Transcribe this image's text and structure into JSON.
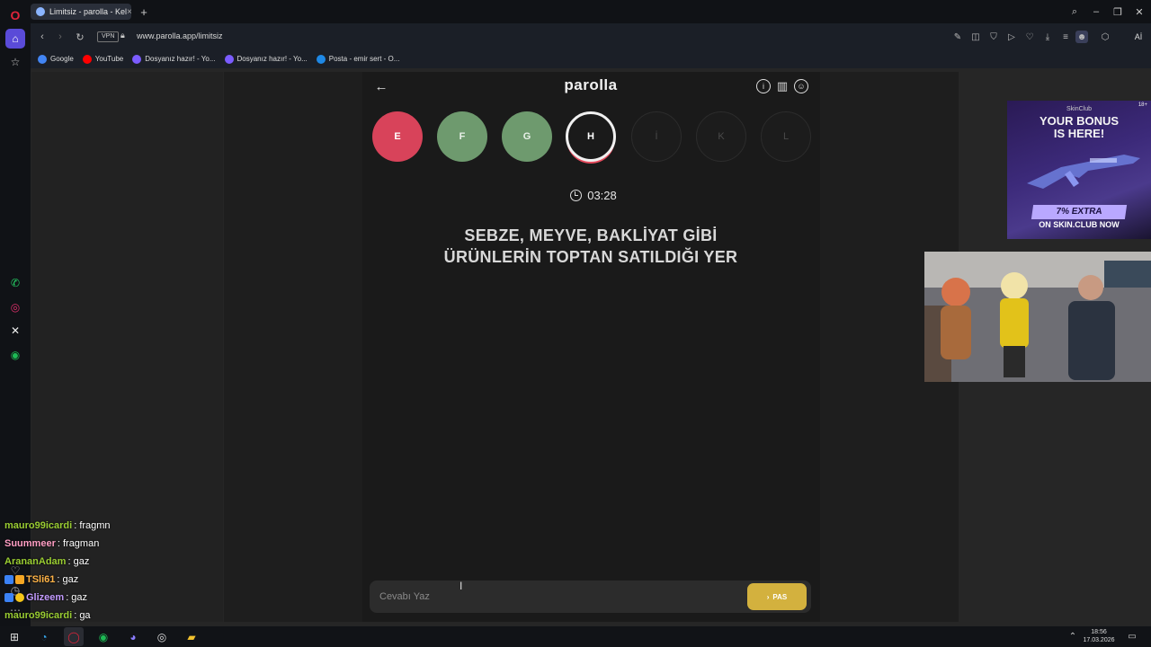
{
  "browser": {
    "tab_title": "Limitsiz - parolla - Kel",
    "tab_close": "×",
    "new_tab": "+",
    "url": "www.parolla.app/limitsiz",
    "vpn_label": "VPN",
    "ai_label": "Aİ"
  },
  "bookmarks": [
    {
      "label": "Google",
      "color": "#4285f4"
    },
    {
      "label": "YouTube",
      "color": "#ff0000"
    },
    {
      "label": "Dosyanız hazır! - Yo...",
      "color": "#7b5cff"
    },
    {
      "label": "Dosyanız hazır! - Yo...",
      "color": "#7b5cff"
    },
    {
      "label": "Posta - emir sert - O...",
      "color": "#1e88e5"
    }
  ],
  "game": {
    "logo": "parolla",
    "back_icon": "←",
    "info_icon": "i",
    "stats_icon": "▥",
    "profile_icon": "☺",
    "letters": [
      {
        "letter": "E",
        "state": "wrong"
      },
      {
        "letter": "F",
        "state": "correct"
      },
      {
        "letter": "G",
        "state": "correct"
      },
      {
        "letter": "H",
        "state": "current"
      },
      {
        "letter": "İ",
        "state": "empty"
      },
      {
        "letter": "K",
        "state": "empty"
      },
      {
        "letter": "L",
        "state": "empty"
      }
    ],
    "timer": "03:28",
    "question_line1": "SEBZE, MEYVE, BAKLİYAT GİBİ",
    "question_line2": "ÜRÜNLERİN TOPTAN SATILDIĞI YER",
    "answer_placeholder": "Cevabı Yaz",
    "pass_label": "PAS",
    "pass_color": "#d3b13e"
  },
  "ad": {
    "brand": "SkinClub",
    "rating": "18+",
    "headline_line1": "YOUR BONUS",
    "headline_line2": "IS HERE!",
    "extra": "7% EXTRA",
    "cta": "ON SKIN.CLUB NOW"
  },
  "chat": [
    {
      "user": "mauro99icardi",
      "message": ": fragmn",
      "color": "#9acd32"
    },
    {
      "user": "Suummeer",
      "message": ": fragman",
      "color": "#ff9ec4"
    },
    {
      "user": "ArananAdam",
      "message": ": gaz",
      "color": "#9acd32"
    },
    {
      "user": "TSli61",
      "message": ": gaz",
      "color": "#ffb347"
    },
    {
      "user": "Glizeem",
      "message": ": gaz",
      "color": "#c39bff"
    },
    {
      "user": "mauro99icardi",
      "message": ": ga",
      "color": "#9acd32"
    }
  ],
  "taskbar": {
    "time": "18:56",
    "date": "17.03.2026"
  }
}
